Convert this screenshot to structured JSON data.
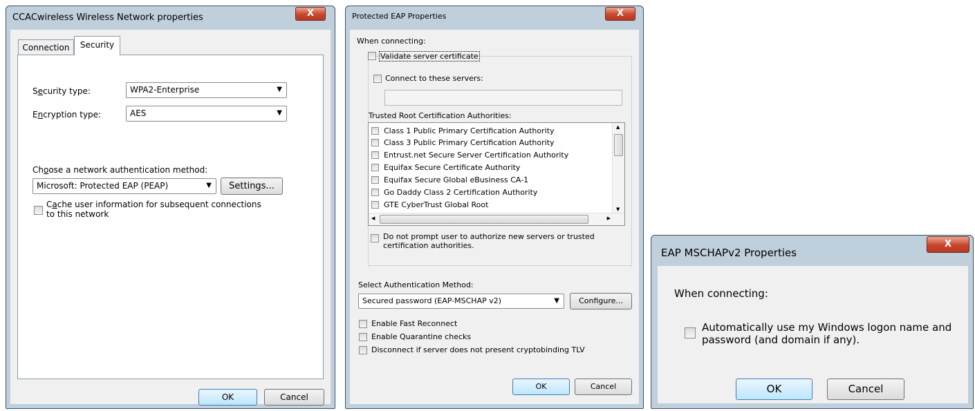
{
  "colors": {
    "title_bar": "#bfcfdc",
    "client": "#f0f0f0",
    "close_button": "#c9462c",
    "default_button": "#bee6fd"
  },
  "window1": {
    "title": "CCACwireless Wireless Network properties",
    "close_glyph": "X",
    "tabs": [
      "Connection",
      "Security"
    ],
    "active_tab": "Security",
    "security_type_label_pre": "S",
    "security_type_label_u": "e",
    "security_type_label_post": "curity type:",
    "security_type_value": "WPA2-Enterprise",
    "encryption_type_label_pre": "E",
    "encryption_type_label_u": "n",
    "encryption_type_label_post": "cryption type:",
    "encryption_type_value": "AES",
    "auth_method_label_pre": "Ch",
    "auth_method_label_u": "o",
    "auth_method_label_post": "ose a network authentication method:",
    "auth_method_value": "Microsoft: Protected EAP (PEAP)",
    "settings_button": "Settings...",
    "cache_label_pre": "C",
    "cache_label_u": "a",
    "cache_label_line1_post": "che user information for subsequent connections",
    "cache_label_line2": "to this network",
    "ok_button": "OK",
    "cancel_button": "Cancel"
  },
  "window2": {
    "title": "Protected EAP Properties",
    "close_glyph": "X",
    "when_connecting": "When connecting:",
    "validate_cert": "Validate server certificate",
    "connect_servers": "Connect to these servers:",
    "servers_value": "",
    "trusted_root_label": "Trusted Root Certification Authorities:",
    "cert_authorities": [
      "Class 1 Public Primary Certification Authority",
      "Class 3 Public Primary Certification Authority",
      "Entrust.net Secure Server Certification Authority",
      "Equifax Secure Certificate Authority",
      "Equifax Secure Global eBusiness CA-1",
      "Go Daddy Class 2 Certification Authority",
      "GTE CyberTrust Global Root"
    ],
    "no_prompt_line1": "Do not prompt user to authorize new servers or trusted",
    "no_prompt_line2": "certification authorities.",
    "select_auth_label": "Select Authentication Method:",
    "auth_method_value": "Secured password (EAP-MSCHAP v2)",
    "configure_button": "Configure...",
    "fast_reconnect": "Enable Fast Reconnect",
    "quarantine": "Enable Quarantine checks",
    "cryptobinding": "Disconnect if server does not present cryptobinding TLV",
    "ok_button": "OK",
    "cancel_button": "Cancel"
  },
  "window3": {
    "title": "EAP MSCHAPv2 Properties",
    "close_glyph": "X",
    "when_connecting": "When connecting:",
    "auto_logon_line1": "Automatically use my Windows logon name and",
    "auto_logon_line2": "password (and domain if any).",
    "ok_button": "OK",
    "cancel_button": "Cancel"
  }
}
